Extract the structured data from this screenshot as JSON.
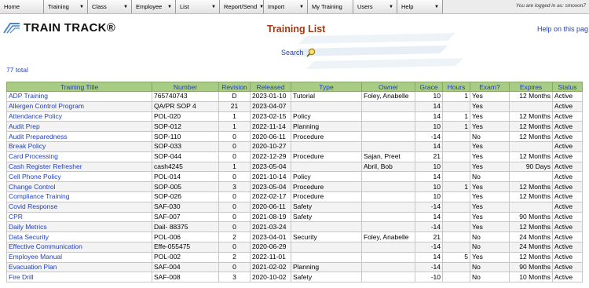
{
  "menu": [
    {
      "label": "Home",
      "arrow": false,
      "w": 56
    },
    {
      "label": "Training",
      "arrow": true,
      "w": 56
    },
    {
      "label": "Class",
      "arrow": true,
      "w": 56
    },
    {
      "label": "Employee",
      "arrow": true,
      "w": 56
    },
    {
      "label": "List",
      "arrow": true,
      "w": 56
    },
    {
      "label": "Report/Send",
      "arrow": true,
      "w": 56
    },
    {
      "label": "Import",
      "arrow": true,
      "w": 56
    },
    {
      "label": "My Training",
      "arrow": false,
      "w": 58
    },
    {
      "label": "Users",
      "arrow": true,
      "w": 56
    },
    {
      "label": "Help",
      "arrow": true,
      "w": 58
    }
  ],
  "login_text": "You are logged in as: smoxon7",
  "logo": {
    "text": "TRAIN TRACK®"
  },
  "page_title": "Training List",
  "help_link": "Help on this pag",
  "search_label": "Search",
  "total": "77 total",
  "columns": [
    "Training Title",
    "Number",
    "Revision",
    "Released",
    "Type",
    "Owner",
    "Grace",
    "Hours",
    "Exam?",
    "Expires",
    "Status"
  ],
  "rows": [
    [
      "ADP Training",
      "765740743",
      "D",
      "2023-01-10",
      "Tutorial",
      "Foley, Anabelle",
      "10",
      "1",
      "Yes",
      "12 Months",
      "Active"
    ],
    [
      "Allergen Control Program",
      "QA/PR SOP 4",
      "21",
      "2023-04-07",
      "",
      "",
      "14",
      "",
      "Yes",
      "",
      "Active"
    ],
    [
      "Attendance Policy",
      "POL-020",
      "1",
      "2023-02-15",
      "Policy",
      "",
      "14",
      "1",
      "Yes",
      "12 Months",
      "Active"
    ],
    [
      "Audit Prep",
      "SOP-012",
      "1",
      "2022-11-14",
      "Planning",
      "",
      "10",
      "1",
      "Yes",
      "12 Months",
      "Active"
    ],
    [
      "Audit Preparedness",
      "SOP-110",
      "0",
      "2020-06-11",
      "Procedure",
      "",
      "-14",
      "",
      "No",
      "12 Months",
      "Active"
    ],
    [
      "Break Policy",
      "SOP-033",
      "0",
      "2020-10-27",
      "",
      "",
      "14",
      "",
      "Yes",
      "",
      "Active"
    ],
    [
      "Card Processing",
      "SOP-044",
      "0",
      "2022-12-29",
      "Procedure",
      "Sajan, Preet",
      "21",
      "",
      "Yes",
      "12 Months",
      "Active"
    ],
    [
      "Cash Register Refresher",
      "cash4245",
      "1",
      "2023-05-04",
      "",
      "Abril, Bob",
      "10",
      "",
      "Yes",
      "90 Days",
      "Active"
    ],
    [
      "Cell Phone Policy",
      "POL-014",
      "0",
      "2021-10-14",
      "Policy",
      "",
      "14",
      "",
      "No",
      "",
      "Active"
    ],
    [
      "Change Control",
      "SOP-005",
      "3",
      "2023-05-04",
      "Procedure",
      "",
      "10",
      "1",
      "Yes",
      "12 Months",
      "Active"
    ],
    [
      "Compliance Training",
      "SOP-026",
      "0",
      "2022-02-17",
      "Procedure",
      "",
      "10",
      "",
      "Yes",
      "12 Months",
      "Active"
    ],
    [
      "Covid Response",
      "SAF-030",
      "0",
      "2020-06-11",
      "Safety",
      "",
      "-14",
      "",
      "Yes",
      "",
      "Active"
    ],
    [
      "CPR",
      "SAF-007",
      "0",
      "2021-08-19",
      "Safety",
      "",
      "14",
      "",
      "Yes",
      "90 Months",
      "Active"
    ],
    [
      "Daily Metrics",
      "Dail- 88375",
      "0",
      "2021-03-24",
      "",
      "",
      "-14",
      "",
      "Yes",
      "12 Months",
      "Active"
    ],
    [
      "Data Security",
      "POL-006",
      "2",
      "2023-04-01",
      "Security",
      "Foley, Anabelle",
      "21",
      "",
      "No",
      "24 Months",
      "Active"
    ],
    [
      "Effective Communication",
      "Effe-055475",
      "0",
      "2020-06-29",
      "",
      "",
      "-14",
      "",
      "No",
      "24 Months",
      "Active"
    ],
    [
      "Employee Manual",
      "POL-002",
      "2",
      "2022-11-01",
      "",
      "",
      "14",
      "5",
      "Yes",
      "12 Months",
      "Active"
    ],
    [
      "Evacuation Plan",
      "SAF-004",
      "0",
      "2021-02-02",
      "Planning",
      "",
      "-14",
      "",
      "No",
      "90 Months",
      "Active"
    ],
    [
      "Fire Drill",
      "SAF-008",
      "3",
      "2020-10-02",
      "Safety",
      "",
      "-10",
      "",
      "No",
      "10 Months",
      "Active"
    ]
  ]
}
